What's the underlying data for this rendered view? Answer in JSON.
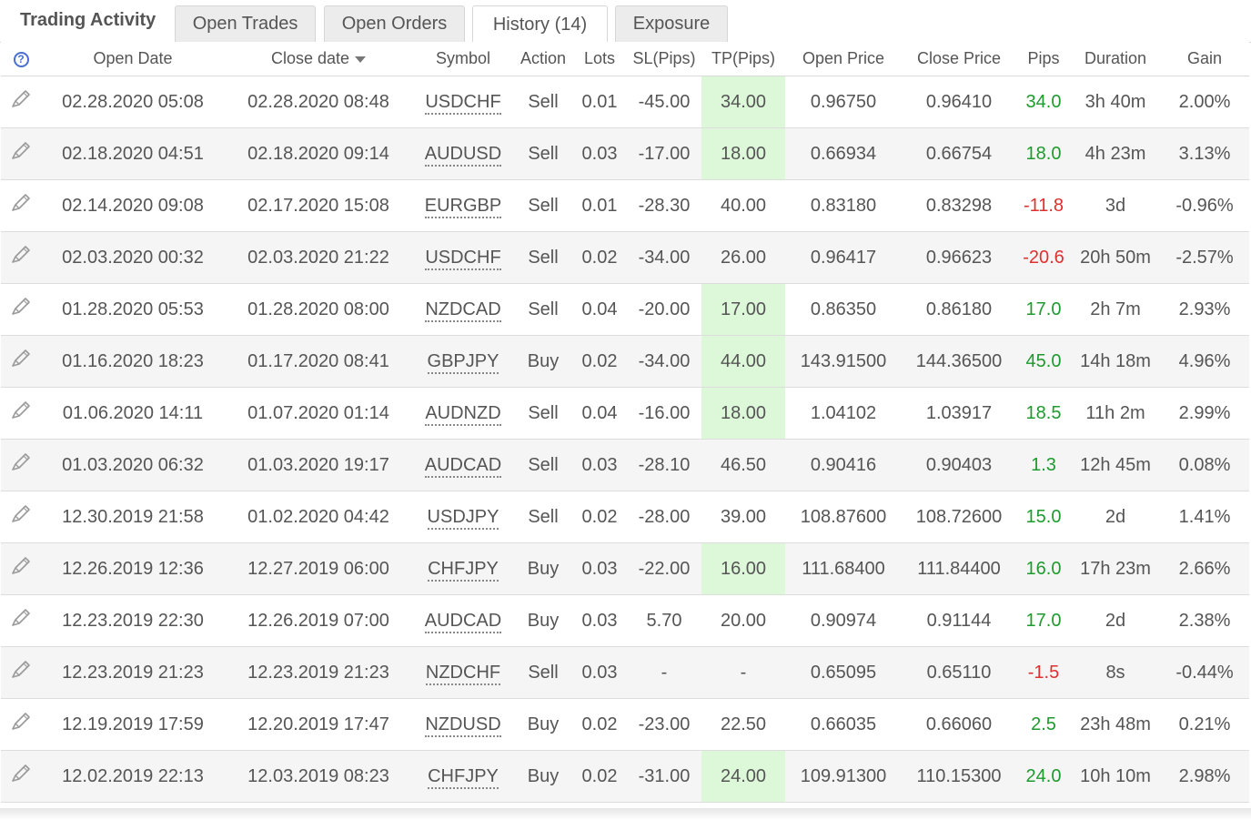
{
  "title": "Trading Activity",
  "tabs": [
    {
      "label": "Open Trades",
      "active": false
    },
    {
      "label": "Open Orders",
      "active": false
    },
    {
      "label": "History (14)",
      "active": true
    },
    {
      "label": "Exposure",
      "active": false
    }
  ],
  "columns": {
    "help": "?",
    "open_date": "Open Date",
    "close_date": "Close date",
    "symbol": "Symbol",
    "action": "Action",
    "lots": "Lots",
    "sl": "SL(Pips)",
    "tp": "TP(Pips)",
    "open_price": "Open Price",
    "close_price": "Close Price",
    "pips": "Pips",
    "duration": "Duration",
    "gain": "Gain"
  },
  "colors": {
    "positive": "#1e9a2e",
    "negative": "#e02f2f",
    "tp_hit": "#dcf8d8"
  },
  "rows": [
    {
      "open_date": "02.28.2020 05:08",
      "close_date": "02.28.2020 08:48",
      "symbol": "USDCHF",
      "action": "Sell",
      "lots": "0.01",
      "sl": "-45.00",
      "tp": "34.00",
      "tp_hit": true,
      "open_price": "0.96750",
      "close_price": "0.96410",
      "pips": "34.0",
      "duration": "3h 40m",
      "gain": "2.00%"
    },
    {
      "open_date": "02.18.2020 04:51",
      "close_date": "02.18.2020 09:14",
      "symbol": "AUDUSD",
      "action": "Sell",
      "lots": "0.03",
      "sl": "-17.00",
      "tp": "18.00",
      "tp_hit": true,
      "open_price": "0.66934",
      "close_price": "0.66754",
      "pips": "18.0",
      "duration": "4h 23m",
      "gain": "3.13%"
    },
    {
      "open_date": "02.14.2020 09:08",
      "close_date": "02.17.2020 15:08",
      "symbol": "EURGBP",
      "action": "Sell",
      "lots": "0.01",
      "sl": "-28.30",
      "tp": "40.00",
      "tp_hit": false,
      "open_price": "0.83180",
      "close_price": "0.83298",
      "pips": "-11.8",
      "duration": "3d",
      "gain": "-0.96%"
    },
    {
      "open_date": "02.03.2020 00:32",
      "close_date": "02.03.2020 21:22",
      "symbol": "USDCHF",
      "action": "Sell",
      "lots": "0.02",
      "sl": "-34.00",
      "tp": "26.00",
      "tp_hit": false,
      "open_price": "0.96417",
      "close_price": "0.96623",
      "pips": "-20.6",
      "duration": "20h 50m",
      "gain": "-2.57%"
    },
    {
      "open_date": "01.28.2020 05:53",
      "close_date": "01.28.2020 08:00",
      "symbol": "NZDCAD",
      "action": "Sell",
      "lots": "0.04",
      "sl": "-20.00",
      "tp": "17.00",
      "tp_hit": true,
      "open_price": "0.86350",
      "close_price": "0.86180",
      "pips": "17.0",
      "duration": "2h 7m",
      "gain": "2.93%"
    },
    {
      "open_date": "01.16.2020 18:23",
      "close_date": "01.17.2020 08:41",
      "symbol": "GBPJPY",
      "action": "Buy",
      "lots": "0.02",
      "sl": "-34.00",
      "tp": "44.00",
      "tp_hit": true,
      "open_price": "143.91500",
      "close_price": "144.36500",
      "pips": "45.0",
      "duration": "14h 18m",
      "gain": "4.96%"
    },
    {
      "open_date": "01.06.2020 14:11",
      "close_date": "01.07.2020 01:14",
      "symbol": "AUDNZD",
      "action": "Sell",
      "lots": "0.04",
      "sl": "-16.00",
      "tp": "18.00",
      "tp_hit": true,
      "open_price": "1.04102",
      "close_price": "1.03917",
      "pips": "18.5",
      "duration": "11h 2m",
      "gain": "2.99%"
    },
    {
      "open_date": "01.03.2020 06:32",
      "close_date": "01.03.2020 19:17",
      "symbol": "AUDCAD",
      "action": "Sell",
      "lots": "0.03",
      "sl": "-28.10",
      "tp": "46.50",
      "tp_hit": false,
      "open_price": "0.90416",
      "close_price": "0.90403",
      "pips": "1.3",
      "duration": "12h 45m",
      "gain": "0.08%"
    },
    {
      "open_date": "12.30.2019 21:58",
      "close_date": "01.02.2020 04:42",
      "symbol": "USDJPY",
      "action": "Sell",
      "lots": "0.02",
      "sl": "-28.00",
      "tp": "39.00",
      "tp_hit": false,
      "open_price": "108.87600",
      "close_price": "108.72600",
      "pips": "15.0",
      "duration": "2d",
      "gain": "1.41%"
    },
    {
      "open_date": "12.26.2019 12:36",
      "close_date": "12.27.2019 06:00",
      "symbol": "CHFJPY",
      "action": "Buy",
      "lots": "0.03",
      "sl": "-22.00",
      "tp": "16.00",
      "tp_hit": true,
      "open_price": "111.68400",
      "close_price": "111.84400",
      "pips": "16.0",
      "duration": "17h 23m",
      "gain": "2.66%"
    },
    {
      "open_date": "12.23.2019 22:30",
      "close_date": "12.26.2019 07:00",
      "symbol": "AUDCAD",
      "action": "Buy",
      "lots": "0.03",
      "sl": "5.70",
      "tp": "20.00",
      "tp_hit": false,
      "open_price": "0.90974",
      "close_price": "0.91144",
      "pips": "17.0",
      "duration": "2d",
      "gain": "2.38%"
    },
    {
      "open_date": "12.23.2019 21:23",
      "close_date": "12.23.2019 21:23",
      "symbol": "NZDCHF",
      "action": "Sell",
      "lots": "0.03",
      "sl": "-",
      "tp": "-",
      "tp_hit": false,
      "open_price": "0.65095",
      "close_price": "0.65110",
      "pips": "-1.5",
      "duration": "8s",
      "gain": "-0.44%"
    },
    {
      "open_date": "12.19.2019 17:59",
      "close_date": "12.20.2019 17:47",
      "symbol": "NZDUSD",
      "action": "Buy",
      "lots": "0.02",
      "sl": "-23.00",
      "tp": "22.50",
      "tp_hit": false,
      "open_price": "0.66035",
      "close_price": "0.66060",
      "pips": "2.5",
      "duration": "23h 48m",
      "gain": "0.21%"
    },
    {
      "open_date": "12.02.2019 22:13",
      "close_date": "12.03.2019 08:23",
      "symbol": "CHFJPY",
      "action": "Buy",
      "lots": "0.02",
      "sl": "-31.00",
      "tp": "24.00",
      "tp_hit": true,
      "open_price": "109.91300",
      "close_price": "110.15300",
      "pips": "24.0",
      "duration": "10h 10m",
      "gain": "2.98%"
    }
  ]
}
